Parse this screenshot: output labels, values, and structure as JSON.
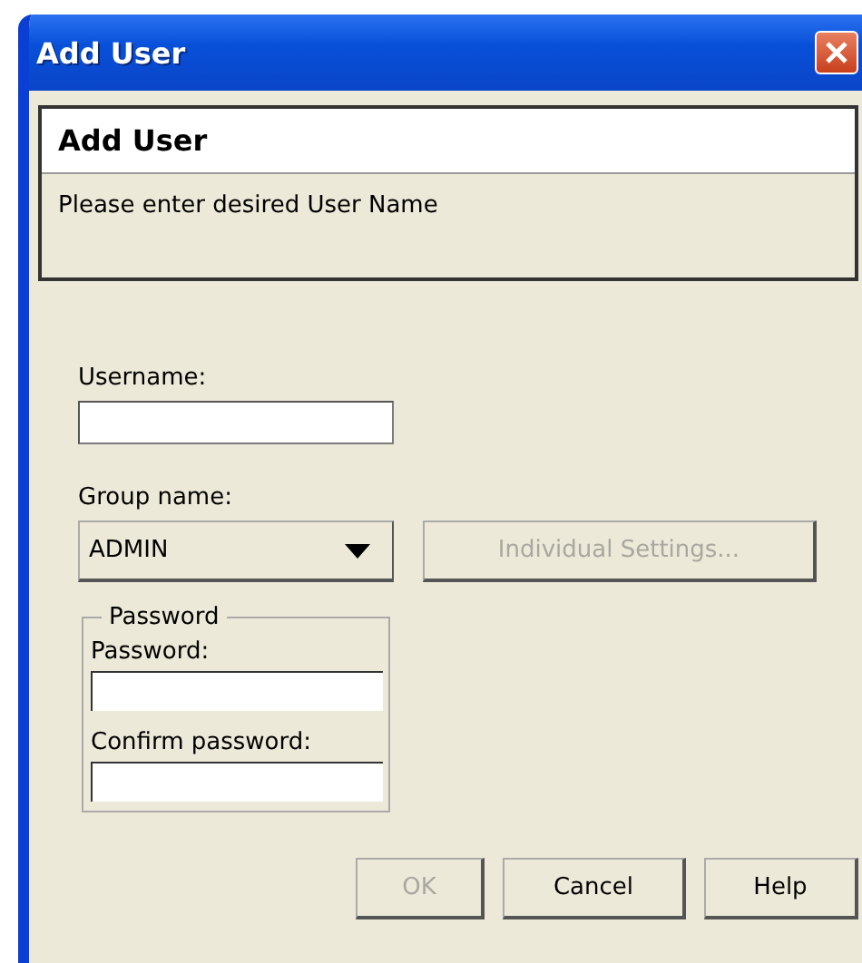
{
  "window": {
    "title": "Add User"
  },
  "header": {
    "title": "Add User",
    "message": "Please enter desired User Name"
  },
  "username": {
    "label": "Username:"
  },
  "group": {
    "label": "Group name:",
    "value": "ADMIN"
  },
  "individual_settings": {
    "label": "Individual Settings...",
    "disabled": true
  },
  "password_group": {
    "legend": "Password",
    "fields": [
      {
        "label": "Password:"
      },
      {
        "label": "Confirm password:"
      }
    ]
  },
  "buttons": [
    {
      "label": "OK",
      "disabled": true
    },
    {
      "label": "Cancel",
      "disabled": false
    },
    {
      "label": "Help",
      "disabled": false
    }
  ]
}
